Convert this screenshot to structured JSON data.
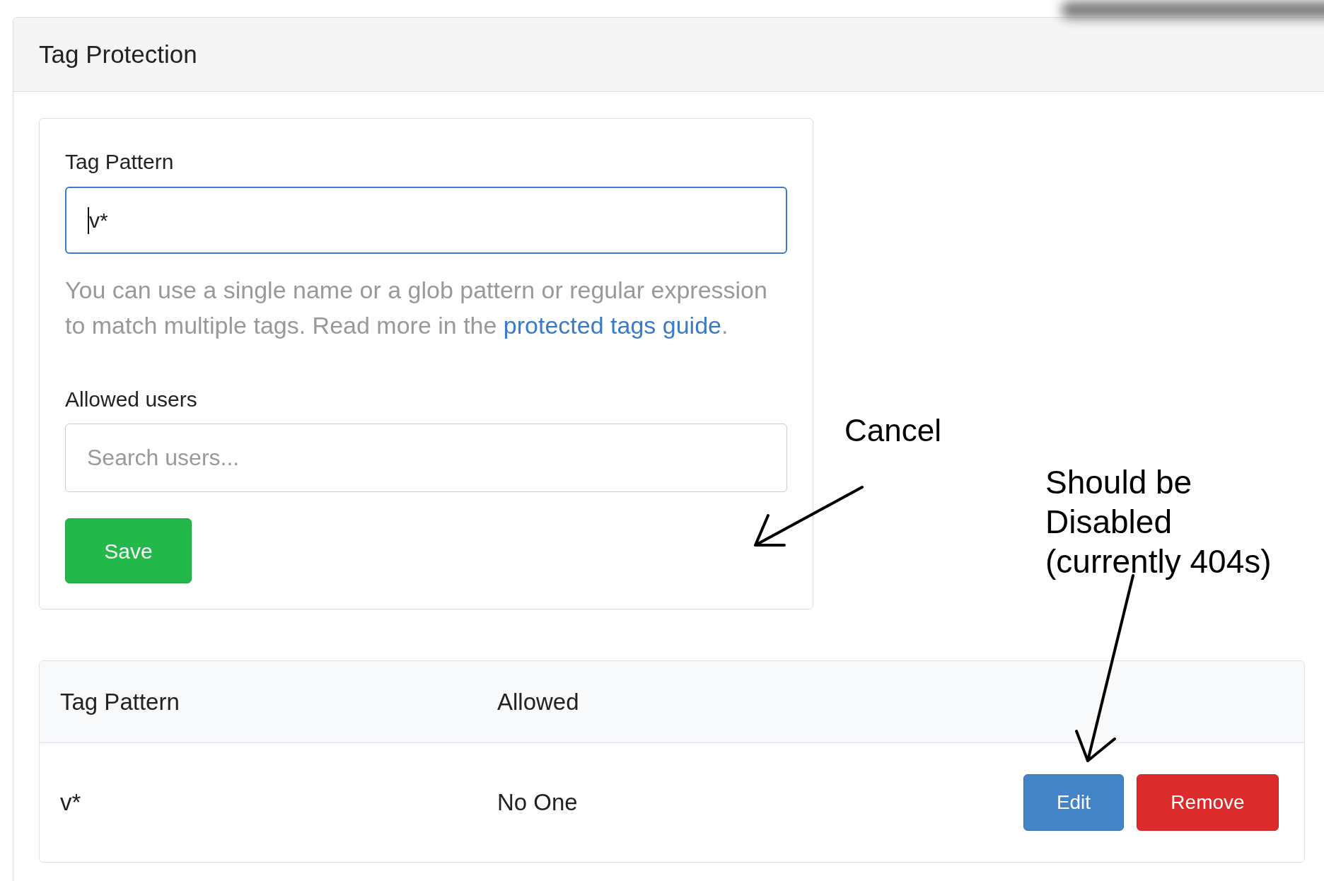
{
  "panel": {
    "title": "Tag Protection"
  },
  "form": {
    "pattern_field": {
      "label": "Tag Pattern",
      "value": "v*",
      "focused": true
    },
    "help_text": {
      "text": "You can use a single name or a glob pattern or regular expression to match multiple tags. Read more in the ",
      "link": "protected tags guide",
      "after": "."
    },
    "users_field": {
      "label": "Allowed users",
      "placeholder": "Search users..."
    },
    "save_button": {
      "label": "Save"
    }
  },
  "table": {
    "columns": [
      "Tag Pattern",
      "Allowed"
    ],
    "rows": [
      {
        "cells": [
          "v*",
          "No One"
        ],
        "actions": [
          {
            "label": "Edit",
            "kind": "edit"
          },
          {
            "label": "Remove",
            "kind": "remove"
          }
        ]
      }
    ]
  },
  "annotations": [
    {
      "text": "Cancel"
    },
    {
      "text": "Should be Disabled (currently 404s)"
    }
  ]
}
